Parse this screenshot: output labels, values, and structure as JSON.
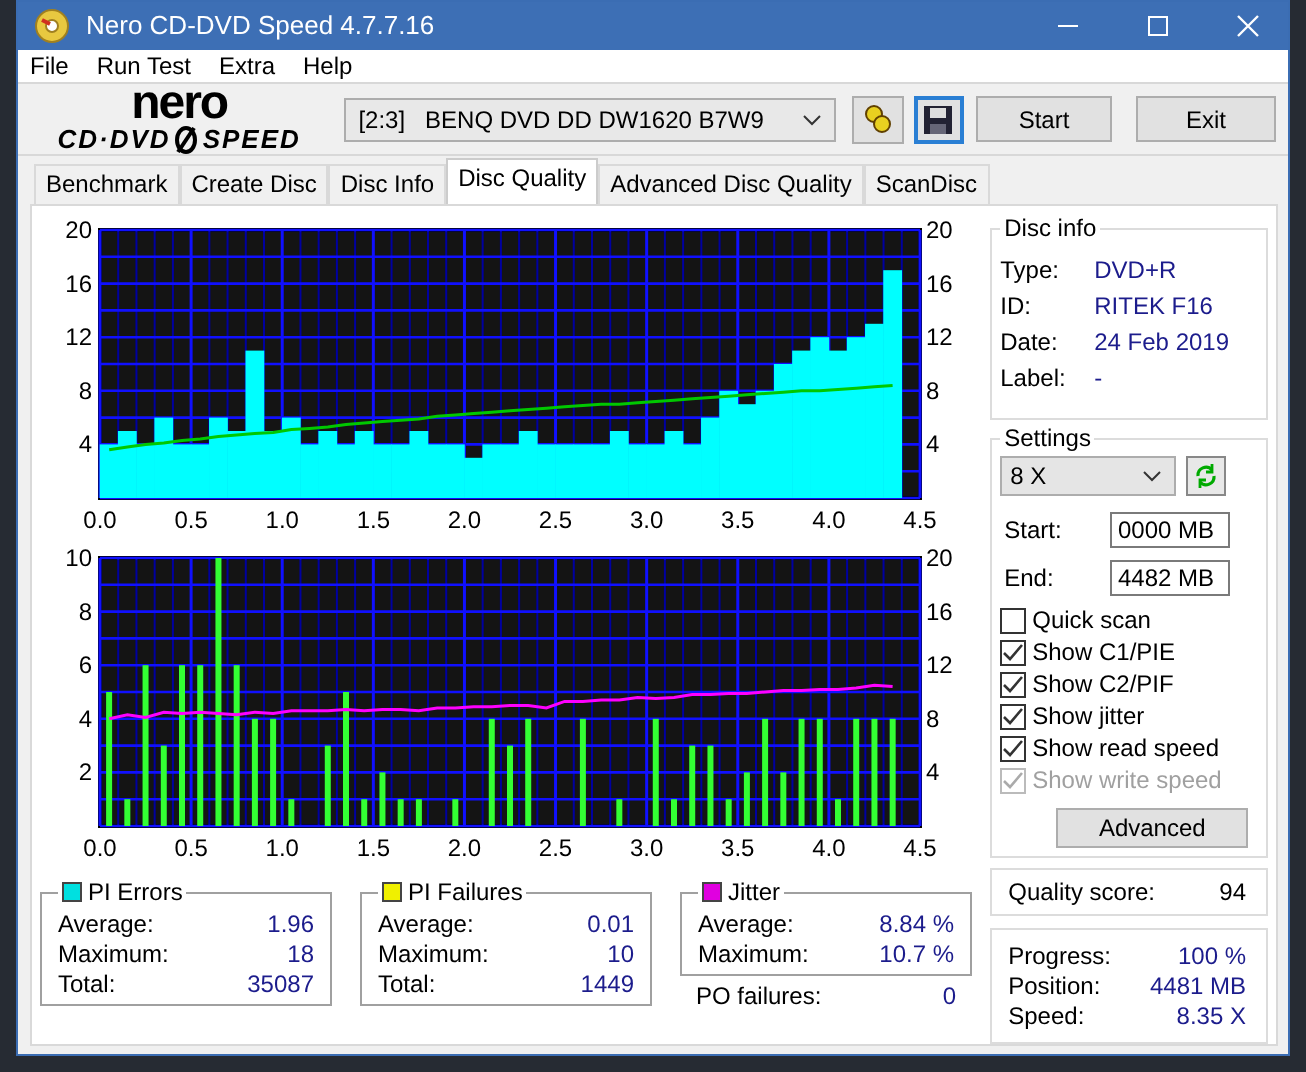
{
  "window": {
    "title": "Nero CD-DVD Speed 4.7.7.16"
  },
  "menu": [
    "File",
    "Run Test",
    "Extra",
    "Help"
  ],
  "logo": {
    "top": "nero",
    "left": "CD·DVD",
    "right": "SPEED"
  },
  "toolbar": {
    "drive_port": "[2:3]",
    "drive_name": "BENQ DVD DD DW1620 B7W9",
    "buttons": [
      "Start",
      "Exit"
    ]
  },
  "tabs": [
    {
      "label": "Benchmark",
      "selected": false
    },
    {
      "label": "Create Disc",
      "selected": false
    },
    {
      "label": "Disc Info",
      "selected": false
    },
    {
      "label": "Disc Quality",
      "selected": true
    },
    {
      "label": "Advanced Disc Quality",
      "selected": false
    },
    {
      "label": "ScanDisc",
      "selected": false
    }
  ],
  "charts": [
    {
      "bars": {
        "chart_data": {
          "type": "bar",
          "x": [
            0.05,
            0.15,
            0.25,
            0.35,
            0.45,
            0.55,
            0.65,
            0.75,
            0.85,
            0.95,
            1.05,
            1.15,
            1.25,
            1.35,
            1.45,
            1.55,
            1.65,
            1.75,
            1.85,
            1.95,
            2.05,
            2.15,
            2.25,
            2.35,
            2.45,
            2.55,
            2.65,
            2.75,
            2.85,
            2.95,
            3.05,
            3.15,
            3.25,
            3.35,
            3.45,
            3.55,
            3.65,
            3.75,
            3.85,
            3.95,
            4.05,
            4.15,
            4.25,
            4.35
          ],
          "series": [
            {
              "color": "#00ffff",
              "values": [
                4,
                5,
                4,
                6,
                4,
                4,
                6,
                5,
                11,
                5,
                6,
                4,
                5,
                4,
                5,
                4,
                4,
                5,
                4,
                4,
                3,
                4,
                4,
                5,
                4,
                4,
                4,
                4,
                5,
                4,
                4,
                5,
                4,
                6,
                8,
                7,
                8,
                10,
                11,
                12,
                11,
                12,
                13,
                17
              ]
            }
          ],
          "xlim": [
            0,
            4.5
          ],
          "ylim": [
            0,
            20
          ],
          "grid": true,
          "xticks": [
            {
              "value": 0,
              "label": "0.0"
            },
            {
              "value": 0.5,
              "label": "0.5"
            },
            {
              "value": 1,
              "label": "1.0"
            },
            {
              "value": 1.5,
              "label": "1.5"
            },
            {
              "value": 2,
              "label": "2.0"
            },
            {
              "value": 2.5,
              "label": "2.5"
            },
            {
              "value": 3,
              "label": "3.0"
            },
            {
              "value": 3.5,
              "label": "3.5"
            },
            {
              "value": 4,
              "label": "4.0"
            },
            {
              "value": 4.5,
              "label": "4.5"
            }
          ],
          "yticks": [
            4,
            8,
            12,
            16,
            20
          ]
        }
      },
      "line": {
        "chart_data": {
          "type": "line",
          "x": [
            0.05,
            0.15,
            0.25,
            0.35,
            0.45,
            0.55,
            0.65,
            0.75,
            0.85,
            0.95,
            1.05,
            1.15,
            1.25,
            1.35,
            1.45,
            1.55,
            1.65,
            1.75,
            1.85,
            1.95,
            2.05,
            2.15,
            2.25,
            2.35,
            2.45,
            2.55,
            2.65,
            2.75,
            2.85,
            2.95,
            3.05,
            3.15,
            3.25,
            3.35,
            3.45,
            3.55,
            3.65,
            3.75,
            3.85,
            3.95,
            4.05,
            4.15,
            4.25,
            4.35
          ],
          "series": [
            {
              "color": "#00c800",
              "values": [
                3.6,
                3.8,
                4.0,
                4.1,
                4.3,
                4.4,
                4.6,
                4.7,
                4.8,
                4.9,
                5.1,
                5.2,
                5.3,
                5.5,
                5.6,
                5.7,
                5.8,
                5.9,
                6.1,
                6.2,
                6.3,
                6.4,
                6.5,
                6.6,
                6.7,
                6.8,
                6.9,
                7.0,
                7.0,
                7.1,
                7.2,
                7.3,
                7.4,
                7.5,
                7.6,
                7.7,
                7.8,
                7.9,
                8.0,
                8.0,
                8.1,
                8.2,
                8.3,
                8.4
              ]
            }
          ],
          "xlim": [
            0,
            4.5
          ],
          "ylim": [
            0,
            20
          ],
          "yticks": [
            4,
            8,
            12,
            16,
            20
          ]
        }
      }
    },
    {
      "bars": {
        "chart_data": {
          "type": "bar",
          "x": [
            0.05,
            0.15,
            0.25,
            0.35,
            0.45,
            0.55,
            0.65,
            0.75,
            0.85,
            0.95,
            1.05,
            1.15,
            1.25,
            1.35,
            1.45,
            1.55,
            1.65,
            1.75,
            1.85,
            1.95,
            2.05,
            2.15,
            2.25,
            2.35,
            2.45,
            2.55,
            2.65,
            2.75,
            2.85,
            2.95,
            3.05,
            3.15,
            3.25,
            3.35,
            3.45,
            3.55,
            3.65,
            3.75,
            3.85,
            3.95,
            4.05,
            4.15,
            4.25,
            4.35
          ],
          "series": [
            {
              "color": "#33ff33",
              "values": [
                5,
                1,
                6,
                3,
                6,
                6,
                10,
                6,
                4,
                4,
                1,
                null,
                3,
                5,
                1,
                2,
                1,
                1,
                null,
                1,
                null,
                4,
                3,
                4,
                null,
                null,
                4,
                null,
                1,
                null,
                4,
                1,
                3,
                3,
                1,
                2,
                4,
                2,
                4,
                4,
                1,
                4,
                4,
                4
              ]
            }
          ],
          "xlim": [
            0,
            4.5
          ],
          "ylim": [
            0,
            10
          ],
          "grid": true,
          "xticks": [
            {
              "value": 0,
              "label": "0.0"
            },
            {
              "value": 0.5,
              "label": "0.5"
            },
            {
              "value": 1,
              "label": "1.0"
            },
            {
              "value": 1.5,
              "label": "1.5"
            },
            {
              "value": 2,
              "label": "2.0"
            },
            {
              "value": 2.5,
              "label": "2.5"
            },
            {
              "value": 3,
              "label": "3.0"
            },
            {
              "value": 3.5,
              "label": "3.5"
            },
            {
              "value": 4,
              "label": "4.0"
            },
            {
              "value": 4.5,
              "label": "4.5"
            }
          ],
          "yticks": [
            2,
            4,
            6,
            8,
            10
          ]
        }
      },
      "line": {
        "chart_data": {
          "type": "line",
          "x": [
            0.05,
            0.15,
            0.25,
            0.35,
            0.45,
            0.55,
            0.65,
            0.75,
            0.85,
            0.95,
            1.05,
            1.15,
            1.25,
            1.35,
            1.45,
            1.55,
            1.65,
            1.75,
            1.85,
            1.95,
            2.05,
            2.15,
            2.25,
            2.35,
            2.45,
            2.55,
            2.65,
            2.75,
            2.85,
            2.95,
            3.05,
            3.15,
            3.25,
            3.35,
            3.45,
            3.55,
            3.65,
            3.75,
            3.85,
            3.95,
            4.05,
            4.15,
            4.25,
            4.35
          ],
          "series": [
            {
              "color": "#ff00ff",
              "values": [
                8.0,
                8.3,
                8.1,
                8.5,
                8.4,
                8.5,
                8.4,
                8.3,
                8.5,
                8.4,
                8.6,
                8.6,
                8.6,
                8.7,
                8.6,
                8.7,
                8.7,
                8.6,
                8.8,
                8.8,
                8.9,
                8.9,
                9.0,
                9.0,
                8.8,
                9.3,
                9.3,
                9.4,
                9.4,
                9.6,
                9.5,
                9.6,
                9.8,
                9.8,
                9.9,
                9.9,
                10.0,
                10.1,
                10.1,
                10.2,
                10.2,
                10.3,
                10.5,
                10.4
              ]
            }
          ],
          "xlim": [
            0,
            4.5
          ],
          "ylim": [
            0,
            20
          ],
          "yticks": [
            4,
            8,
            12,
            16,
            20
          ]
        }
      }
    }
  ],
  "disc_info": {
    "title": "Disc info",
    "rows": [
      {
        "label": "Type:",
        "value": "DVD+R"
      },
      {
        "label": "ID:",
        "value": "RITEK F16"
      },
      {
        "label": "Date:",
        "value": "24 Feb 2019"
      },
      {
        "label": "Label:",
        "value": "-"
      }
    ]
  },
  "settings": {
    "title": "Settings",
    "speed": "8 X",
    "start": {
      "label": "Start:",
      "value": "0000 MB"
    },
    "end": {
      "label": "End:",
      "value": "4482 MB"
    },
    "options": [
      {
        "label": "Quick scan",
        "checked": false,
        "disabled": false
      },
      {
        "label": "Show C1/PIE",
        "checked": true,
        "disabled": false
      },
      {
        "label": "Show C2/PIF",
        "checked": true,
        "disabled": false
      },
      {
        "label": "Show jitter",
        "checked": true,
        "disabled": false
      },
      {
        "label": "Show read speed",
        "checked": true,
        "disabled": false
      },
      {
        "label": "Show write speed",
        "checked": true,
        "disabled": true
      }
    ],
    "advanced": "Advanced"
  },
  "quality": {
    "label": "Quality score:",
    "value": "94"
  },
  "stats": [
    {
      "title": "PI Errors",
      "color": "#00e0e0",
      "rows": [
        {
          "label": "Average:",
          "value": "1.96"
        },
        {
          "label": "Maximum:",
          "value": "18"
        },
        {
          "label": "Total:",
          "value": "35087"
        }
      ]
    },
    {
      "title": "PI Failures",
      "color": "#f0f000",
      "rows": [
        {
          "label": "Average:",
          "value": "0.01"
        },
        {
          "label": "Maximum:",
          "value": "10"
        },
        {
          "label": "Total:",
          "value": "1449"
        }
      ]
    },
    {
      "title": "Jitter",
      "color": "#e000e0",
      "rows": [
        {
          "label": "Average:",
          "value": "8.84 %"
        },
        {
          "label": "Maximum:",
          "value": "10.7 %"
        }
      ],
      "footer": {
        "label": "PO failures:",
        "value": "0"
      }
    }
  ],
  "progress": [
    {
      "label": "Progress:",
      "value": "100 %"
    },
    {
      "label": "Position:",
      "value": "4481 MB"
    },
    {
      "label": "Speed:",
      "value": "8.35 X"
    }
  ]
}
